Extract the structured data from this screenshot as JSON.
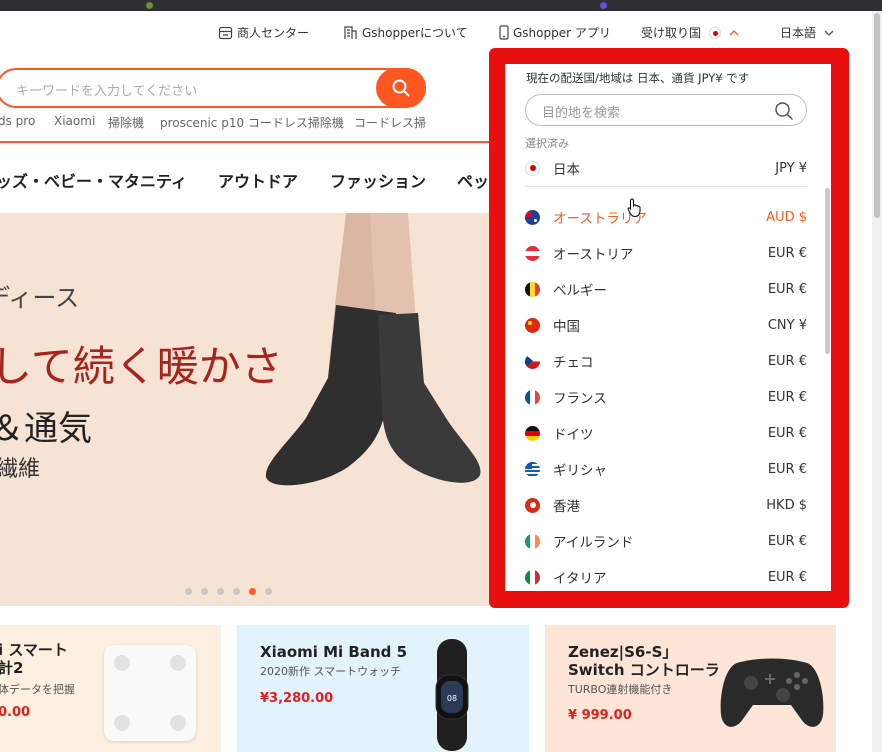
{
  "topnav": {
    "merchant_center": "商人センター",
    "about": "Gshopperについて",
    "app": "Gshopper アプリ",
    "ship_to": "受け取り国",
    "language": "日本語"
  },
  "search": {
    "placeholder": "キーワードを入力してください",
    "hot_keywords": [
      "ds pro",
      "Xiaomi",
      "掃除機",
      "proscenic p10 コードレス掃除機",
      "コードレス掃"
    ]
  },
  "categories": [
    "ッズ・ベビー・マタニティ",
    "アウトドア",
    "ファッション",
    "ペッ"
  ],
  "banner": {
    "line1": "ディース",
    "line2": "して続く暖かさ",
    "line3": "＆通気",
    "line4": "繊維",
    "slide_count": 6,
    "active_slide": 5
  },
  "products": [
    {
      "name_line1": "i スマート",
      "name_line2": "計2",
      "sub": "体データを把握",
      "price": "0.00"
    },
    {
      "name_line1": "Xiaomi Mi Band 5",
      "name_line2": "",
      "sub": "2020新作 スマートウォッチ",
      "price": "¥3,280.00"
    },
    {
      "name_line1": "Zenez|S6-S」",
      "name_line2": "Switch コントローラ",
      "sub": "TURBO連射機能付き",
      "price": "¥ 999.00"
    }
  ],
  "dropdown": {
    "info": "現在の配送国/地域は 日本、通貨 JPY¥ です",
    "search_placeholder": "目的地を検索",
    "selected_label": "選択済み",
    "selected": {
      "country": "日本",
      "currency": "JPY ¥",
      "flag": "japan"
    },
    "countries": [
      {
        "country": "オーストラリア",
        "currency": "AUD $",
        "flag": "australia",
        "highlighted": true
      },
      {
        "country": "オーストリア",
        "currency": "EUR €",
        "flag": "austria"
      },
      {
        "country": "ベルギー",
        "currency": "EUR €",
        "flag": "belgium"
      },
      {
        "country": "中国",
        "currency": "CNY ¥",
        "flag": "china"
      },
      {
        "country": "チェコ",
        "currency": "EUR €",
        "flag": "czech"
      },
      {
        "country": "フランス",
        "currency": "EUR €",
        "flag": "france"
      },
      {
        "country": "ドイツ",
        "currency": "EUR €",
        "flag": "germany"
      },
      {
        "country": "ギリシャ",
        "currency": "EUR €",
        "flag": "greece"
      },
      {
        "country": "香港",
        "currency": "HKD $",
        "flag": "hongkong"
      },
      {
        "country": "アイルランド",
        "currency": "EUR €",
        "flag": "ireland"
      },
      {
        "country": "イタリア",
        "currency": "EUR €",
        "flag": "italy"
      }
    ]
  },
  "colors": {
    "accent": "#ff5722",
    "highlight_frame": "#ea0f0f",
    "price": "#e02020"
  }
}
